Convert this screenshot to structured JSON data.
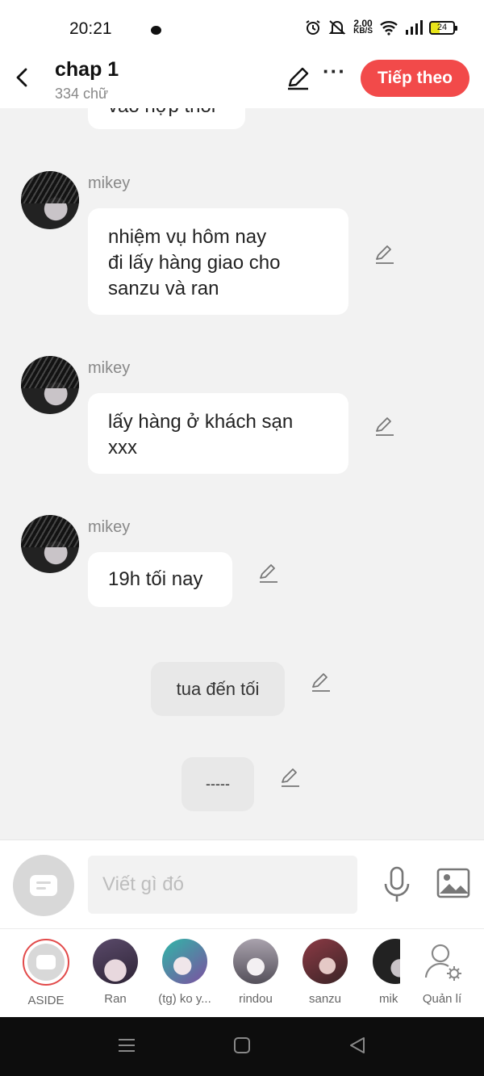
{
  "status_bar": {
    "time": "20:21",
    "net_speed_value": "2.00",
    "net_speed_unit": "KB/S",
    "battery": "24"
  },
  "header": {
    "title": "chap 1",
    "word_count": "334 chữ",
    "next_label": "Tiếp theo",
    "more_label": "···"
  },
  "messages": [
    {
      "text": "vào hợp thôi"
    },
    {
      "speaker": "mikey",
      "text": "nhiệm vụ hôm nay\nđi lấy hàng giao cho\nsanzu và ran"
    },
    {
      "speaker": "mikey",
      "text": "lấy hàng ở khách sạn\nxxx"
    },
    {
      "speaker": "mikey",
      "text": "19h tối nay"
    }
  ],
  "narration": [
    {
      "text": "tua đến tối"
    },
    {
      "text": "-----"
    }
  ],
  "input": {
    "placeholder": "Viết gì đó"
  },
  "characters": [
    {
      "label": "ASIDE"
    },
    {
      "label": "Ran"
    },
    {
      "label": "(tg) ko y..."
    },
    {
      "label": "rindou"
    },
    {
      "label": "sanzu"
    },
    {
      "label": "mik"
    },
    {
      "label": "Quản lí"
    }
  ],
  "colors": {
    "accent": "#f24a4a",
    "chat_bg": "#f2f2f2",
    "bubble": "#ffffff"
  }
}
